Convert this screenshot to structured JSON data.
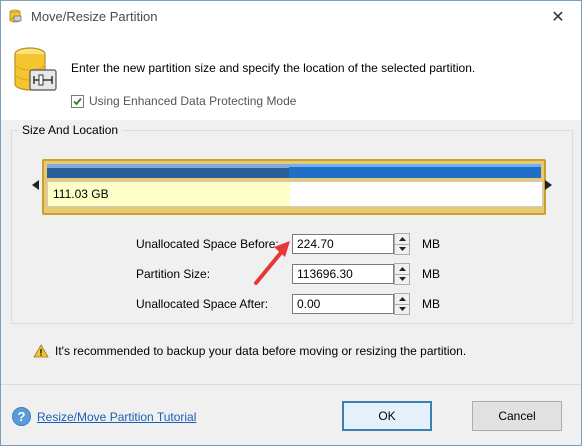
{
  "window": {
    "title": "Move/Resize Partition",
    "close_symbol": "✕"
  },
  "header": {
    "instruction": "Enter the new partition size and specify the location of the selected partition.",
    "checkbox_label": "Using Enhanced Data Protecting Mode",
    "checkbox_checked": true
  },
  "group": {
    "title": "Size And Location",
    "partition_capacity": "111.03 GB",
    "used_fraction": 0.49,
    "capacity_fraction": 0.49
  },
  "fields": [
    {
      "label": "Unallocated Space Before:",
      "value": "224.70",
      "unit": "MB"
    },
    {
      "label": "Partition Size:",
      "value": "113696.30",
      "unit": "MB"
    },
    {
      "label": "Unallocated Space After:",
      "value": "0.00",
      "unit": "MB"
    }
  ],
  "warning": "It's recommended to backup your data before moving or resizing the partition.",
  "help_link": "Resize/Move Partition Tutorial",
  "buttons": {
    "ok": "OK",
    "cancel": "Cancel"
  },
  "colors": {
    "partition_border": "#c8a030",
    "used_bar": "#2a5d99",
    "free_bar": "#1f6fc8",
    "annotation_arrow": "#e53935"
  }
}
